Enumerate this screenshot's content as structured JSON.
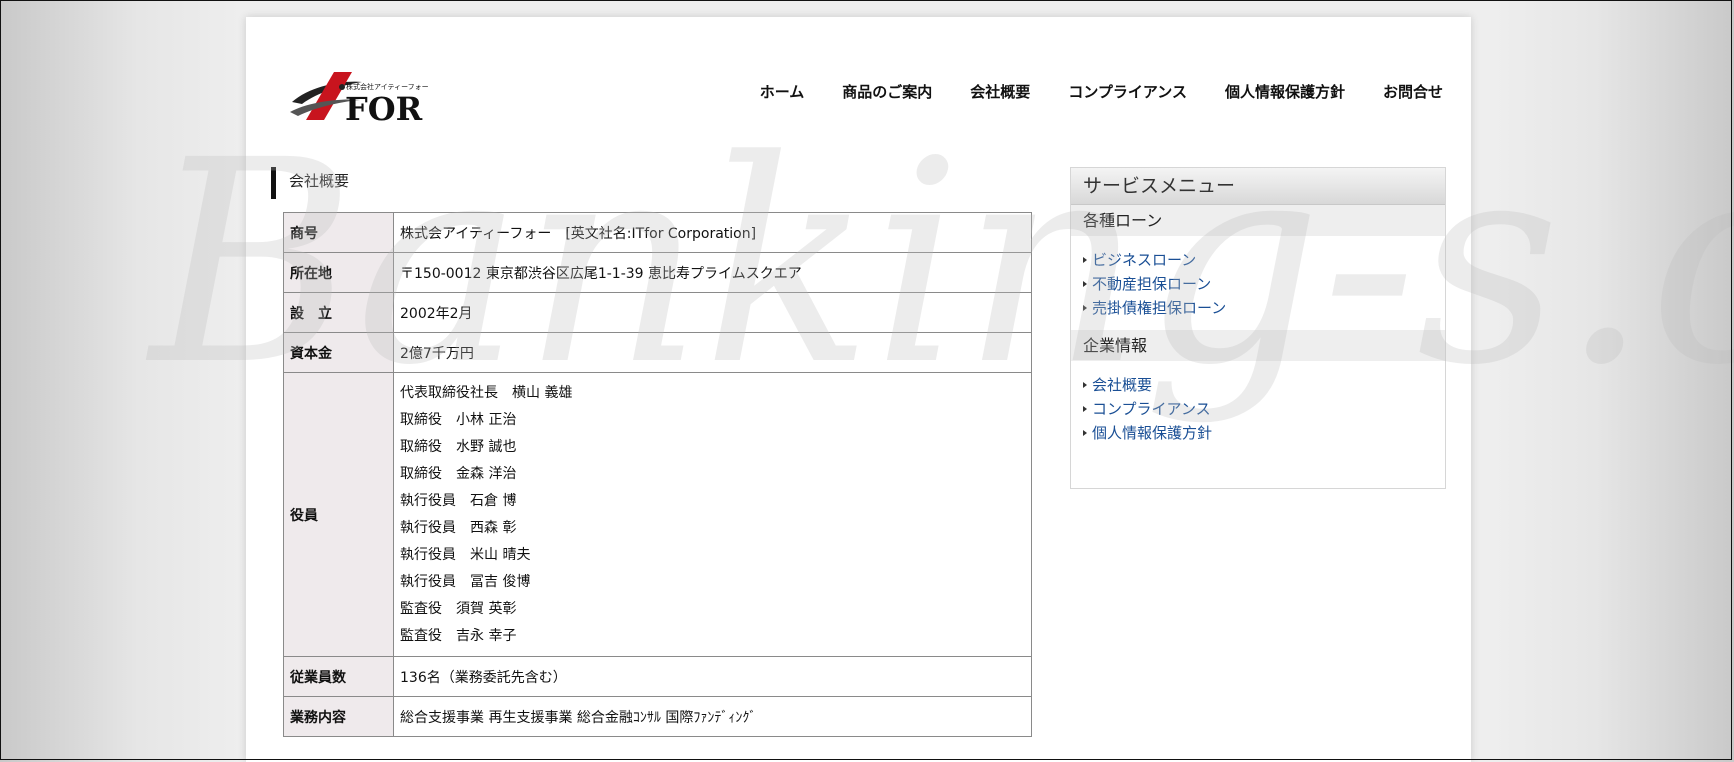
{
  "watermark": "Banking-s.com",
  "logo": {
    "mark": "I",
    "text": "FOR",
    "small_text": "株式会社アイティーフォー"
  },
  "nav": [
    "ホーム",
    "商品のご案内",
    "会社概要",
    "コンプライアンス",
    "個人情報保護方針",
    "お問合せ"
  ],
  "heading": "会社概要",
  "info": {
    "rows": [
      {
        "label": "商号",
        "value": "株式会アイティーフォー　[英文社名:ITfor Corporation]"
      },
      {
        "label": "所在地",
        "value": "〒150-0012 東京都渋谷区広尾1-1-39 恵比寿プライムスクエア"
      },
      {
        "label": "設　立",
        "value": "2002年2月"
      },
      {
        "label": "資本金",
        "value": "2億7千万円"
      }
    ],
    "officers_label": "役員",
    "officers": [
      "代表取締役社長　横山 義雄",
      "取締役　小林 正治",
      "取締役　水野 誠也",
      "取締役　金森 洋治",
      "執行役員　石倉 博",
      "執行役員　西森 彰",
      "執行役員　米山 晴夫",
      "執行役員　冨吉 俊博",
      "監査役　須賀 英彰",
      "監査役　吉永 幸子"
    ],
    "rows_after": [
      {
        "label": "従業員数",
        "value": "136名（業務委託先含む）"
      },
      {
        "label": "業務内容",
        "value": "総合支援事業 再生支援事業 総合金融ｺﾝｻﾙ 国際ﾌｧﾝﾃﾞｨﾝｸﾞ"
      }
    ]
  },
  "sidebar": {
    "title": "サービスメニュー",
    "sections": [
      {
        "title": "各種ローン",
        "items": [
          "ビジネスローン",
          "不動産担保ローン",
          "売掛債権担保ローン"
        ]
      },
      {
        "title": "企業情報",
        "items": [
          "会社概要",
          "コンプライアンス",
          "個人情報保護方針"
        ]
      }
    ]
  },
  "colors": {
    "link": "#1a4f95",
    "logo_red": "#c8141e",
    "th_bg": "#efeaec"
  }
}
